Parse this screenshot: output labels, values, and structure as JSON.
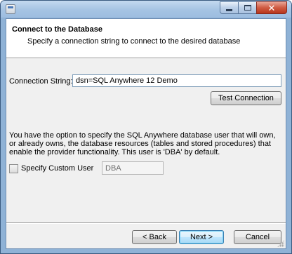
{
  "window": {
    "title": "",
    "app_icon": "setup-wizard-icon",
    "minimize_glyph": "",
    "maximize_glyph": "",
    "close_glyph": "✕"
  },
  "header": {
    "title": "Connect to the Database",
    "subtitle": "Specify a connection string to connect to the desired database"
  },
  "connection": {
    "label": "Connection String:",
    "value": "dsn=SQL Anywhere 12 Demo",
    "test_button": "Test Connection"
  },
  "info_text": "You have the option to specify the SQL Anywhere database user that will own, or already owns, the database resources (tables and stored procedures) that enable the provider functionality. This user is 'DBA' by default.",
  "custom_user": {
    "checkbox_label": "Specify Custom User",
    "checked": false,
    "value": "DBA",
    "enabled": false
  },
  "buttons": {
    "back": "< Back",
    "next": "Next >",
    "cancel": "Cancel"
  },
  "colors": {
    "titlebar": "#a5c3e3",
    "dialog_bg": "#f0f0f0",
    "header_bg": "#ffffff",
    "close_button": "#cf5b42",
    "default_button_border": "#3c7fb1"
  }
}
